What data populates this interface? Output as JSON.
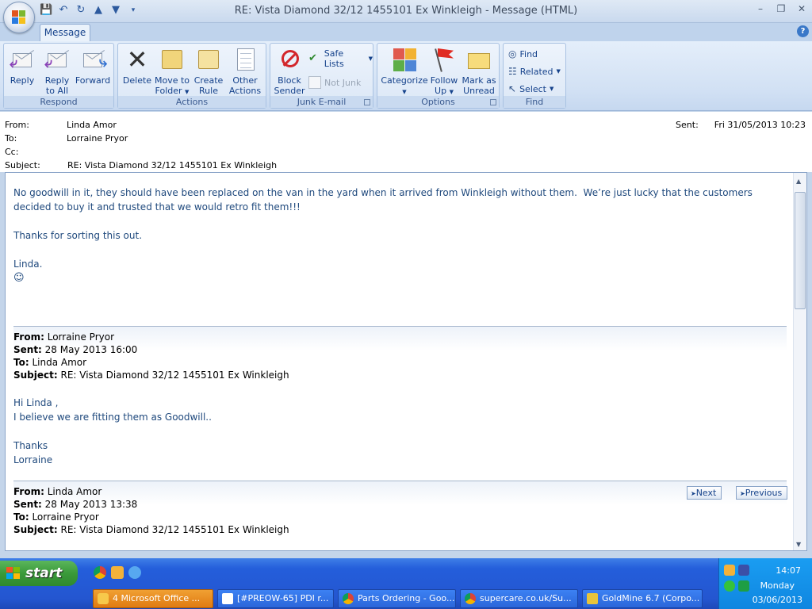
{
  "window": {
    "title": "RE: Vista Diamond 32/12 1455101 Ex Winkleigh - Message (HTML)"
  },
  "ribbon": {
    "tab": "Message",
    "groups": {
      "respond": {
        "label": "Respond",
        "reply": "Reply",
        "reply_all_1": "Reply",
        "reply_all_2": "to All",
        "forward": "Forward"
      },
      "actions": {
        "label": "Actions",
        "delete": "Delete",
        "move_1": "Move to",
        "move_2": "Folder",
        "create_1": "Create",
        "create_2": "Rule",
        "other_1": "Other",
        "other_2": "Actions"
      },
      "junk": {
        "label": "Junk E-mail",
        "block_1": "Block",
        "block_2": "Sender",
        "safe_lists": "Safe Lists",
        "not_junk": "Not Junk"
      },
      "options": {
        "label": "Options",
        "categorize": "Categorize",
        "follow_1": "Follow",
        "follow_2": "Up",
        "mark_1": "Mark as",
        "mark_2": "Unread"
      },
      "find": {
        "label": "Find",
        "find": "Find",
        "related": "Related",
        "select": "Select"
      }
    }
  },
  "header": {
    "from_label": "From:",
    "from": "Linda Amor",
    "to_label": "To:",
    "to": "Lorraine Pryor",
    "cc_label": "Cc:",
    "subject_label": "Subject:",
    "subject": "RE: Vista Diamond 32/12 1455101 Ex Winkleigh",
    "sent_label": "Sent:",
    "sent": "Fri 31/05/2013 10:23"
  },
  "body": {
    "para1_line1": "No goodwill in it, they should have been replaced on the van in the yard when it arrived from Winkleigh without them.  We’re just lucky that the customers",
    "para1_line2": "decided to buy it and trusted that we would retro fit them!!!",
    "para2": "Thanks for sorting this out.",
    "sign": "Linda.",
    "smiley": "☺",
    "quoted1": {
      "from_label": "From:",
      "from": " Lorraine Pryor",
      "sent_label": "Sent:",
      "sent": " 28 May 2013 16:00",
      "to_label": "To:",
      "to": " Linda Amor",
      "subject_label": "Subject:",
      "subject": " RE: Vista Diamond 32/12 1455101 Ex Winkleigh",
      "line1": "Hi Linda ,",
      "line2": "I believe we are fitting them as Goodwill..",
      "line3": "Thanks",
      "line4": "Lorraine"
    },
    "quoted2": {
      "from_label": "From:",
      "from": " Linda Amor",
      "sent_label": "Sent:",
      "sent": " 28 May 2013 13:38",
      "to_label": "To:",
      "to": " Lorraine Pryor",
      "subject_label": "Subject:",
      "subject": " RE: Vista Diamond 32/12 1455101 Ex Winkleigh"
    },
    "next": "Next",
    "previous": "Previous"
  },
  "taskbar": {
    "start": "start",
    "tasks": [
      "4 Microsoft Office ...",
      "[#PREOW-65] PDI r...",
      "Parts Ordering - Goo...",
      "supercare.co.uk/Su...",
      "GoldMine 6.7 (Corpo..."
    ],
    "time": "14:07",
    "day": "Monday",
    "date": "03/06/2013"
  }
}
